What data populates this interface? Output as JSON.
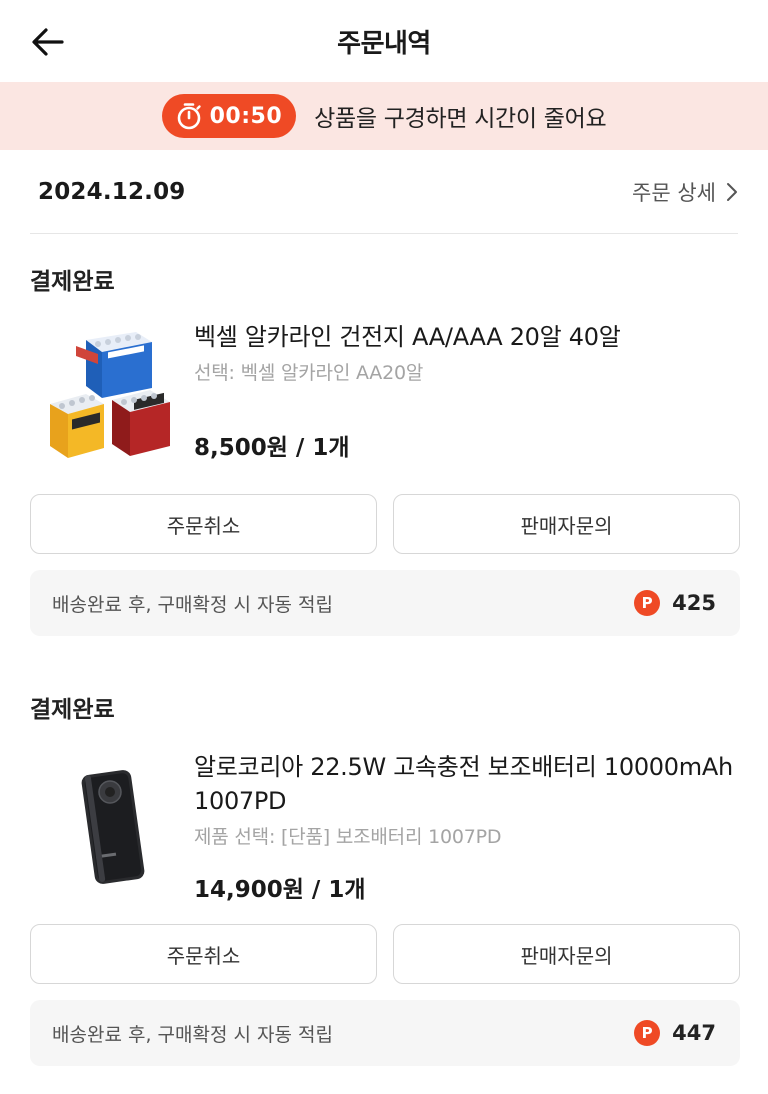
{
  "header": {
    "title": "주문내역"
  },
  "timer": {
    "value": "00:50",
    "message": "상품을 구경하면 시간이 줄어요"
  },
  "order": {
    "date": "2024.12.09",
    "detail_label": "주문 상세"
  },
  "items": [
    {
      "status": "결제완료",
      "name": "벡셀 알카라인 건전지 AA/AAA 20알 40알",
      "option": "선택: 벡셀 알카라인 AA20알",
      "price": "8,500원 / 1개",
      "cancel_label": "주문취소",
      "inquiry_label": "판매자문의",
      "point_text": "배송완료 후, 구매확정 시 자동 적립",
      "point_badge": "P",
      "point_value": "425"
    },
    {
      "status": "결제완료",
      "name": "알로코리아 22.5W 고속충전 보조배터리 10000mAh 1007PD",
      "option": "제품 선택: [단품] 보조배터리 1007PD",
      "price": "14,900원 / 1개",
      "cancel_label": "주문취소",
      "inquiry_label": "판매자문의",
      "point_text": "배송완료 후, 구매확정 시 자동 적립",
      "point_badge": "P",
      "point_value": "447"
    }
  ],
  "colors": {
    "accent": "#ef4a25",
    "banner_bg": "#fbe6e2"
  }
}
